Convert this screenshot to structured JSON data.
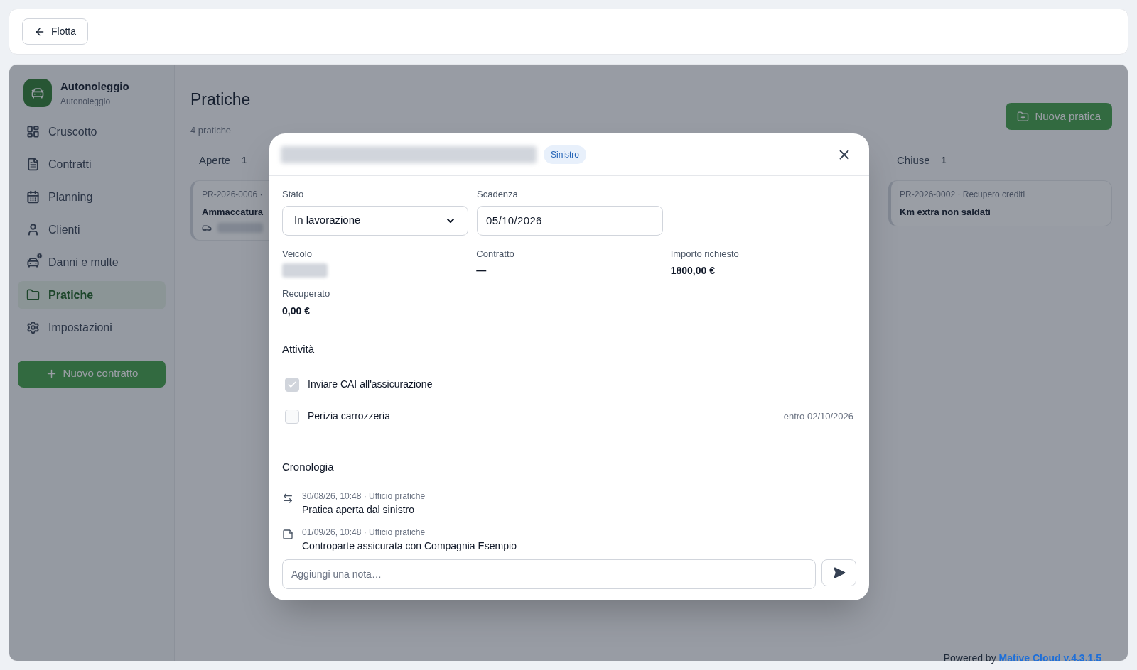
{
  "top_bar": {
    "back_button": "Flotta"
  },
  "sidebar": {
    "app_name": "Autonoleggio",
    "app_subtitle": "Autonoleggio",
    "items": [
      {
        "label": "Cruscotto",
        "kind": "dashboard",
        "selected": false
      },
      {
        "label": "Contratti",
        "kind": "document",
        "selected": false
      },
      {
        "label": "Planning",
        "kind": "calendar",
        "selected": false
      },
      {
        "label": "Clienti",
        "kind": "person",
        "selected": false
      },
      {
        "label": "Danni e multe",
        "kind": "damage",
        "selected": false
      },
      {
        "label": "Pratiche",
        "kind": "folder",
        "selected": true
      },
      {
        "label": "Impostazioni",
        "kind": "settings",
        "selected": false
      }
    ],
    "new_button": "Nuovo contratto"
  },
  "page": {
    "title": "Pratiche",
    "count": "4 pratiche",
    "new_button": "Nuova pratica",
    "columns": [
      {
        "title": "Aperte",
        "count": "1",
        "cards": [
          {
            "ref": "PR-2026-0006 ·",
            "title": "Ammaccatura",
            "has_vehicle": true
          }
        ]
      },
      {
        "title": "Chiuse",
        "count": "1",
        "cards": [
          {
            "ref": "PR-2026-0002 · Recupero crediti",
            "title": "Km extra non saldati",
            "has_vehicle": false
          }
        ]
      }
    ]
  },
  "modal": {
    "badge": "Sinistro",
    "fields": [
      {
        "label": "Stato",
        "kind": "select",
        "value": "In lavorazione"
      },
      {
        "label": "Scadenza",
        "kind": "date",
        "value": "05/10/2026"
      }
    ],
    "details": [
      {
        "label": "Veicolo",
        "kind": "redacted"
      },
      {
        "label": "Contratto",
        "kind": "text",
        "value": "—"
      },
      {
        "label": "Importo richiesto",
        "kind": "text",
        "value": "1800,00 €"
      },
      {
        "label": "Recuperato",
        "kind": "text",
        "value": "0,00 €"
      }
    ],
    "activities": {
      "title": "Attività",
      "items": [
        {
          "label": "Inviare CAI all'assicurazione",
          "checked": true
        },
        {
          "label": "Perizia carrozzeria",
          "checked": false,
          "due": "entro 02/10/2026"
        }
      ]
    },
    "history": {
      "title": "Cronologia",
      "events": [
        {
          "kind": "status",
          "meta": "30/08/26, 10:48 · Ufficio pratiche",
          "text": "Pratica aperta dal sinistro"
        },
        {
          "kind": "note",
          "meta": "01/09/26, 10:48 · Ufficio pratiche",
          "text": "Controparte assicurata con Compagnia Esempio"
        }
      ]
    },
    "note_input": {
      "placeholder": "Aggiungi una nota…"
    }
  },
  "footer": {
    "prefix": "Powered by",
    "link": "Mative Cloud v.4.3.1.5"
  }
}
